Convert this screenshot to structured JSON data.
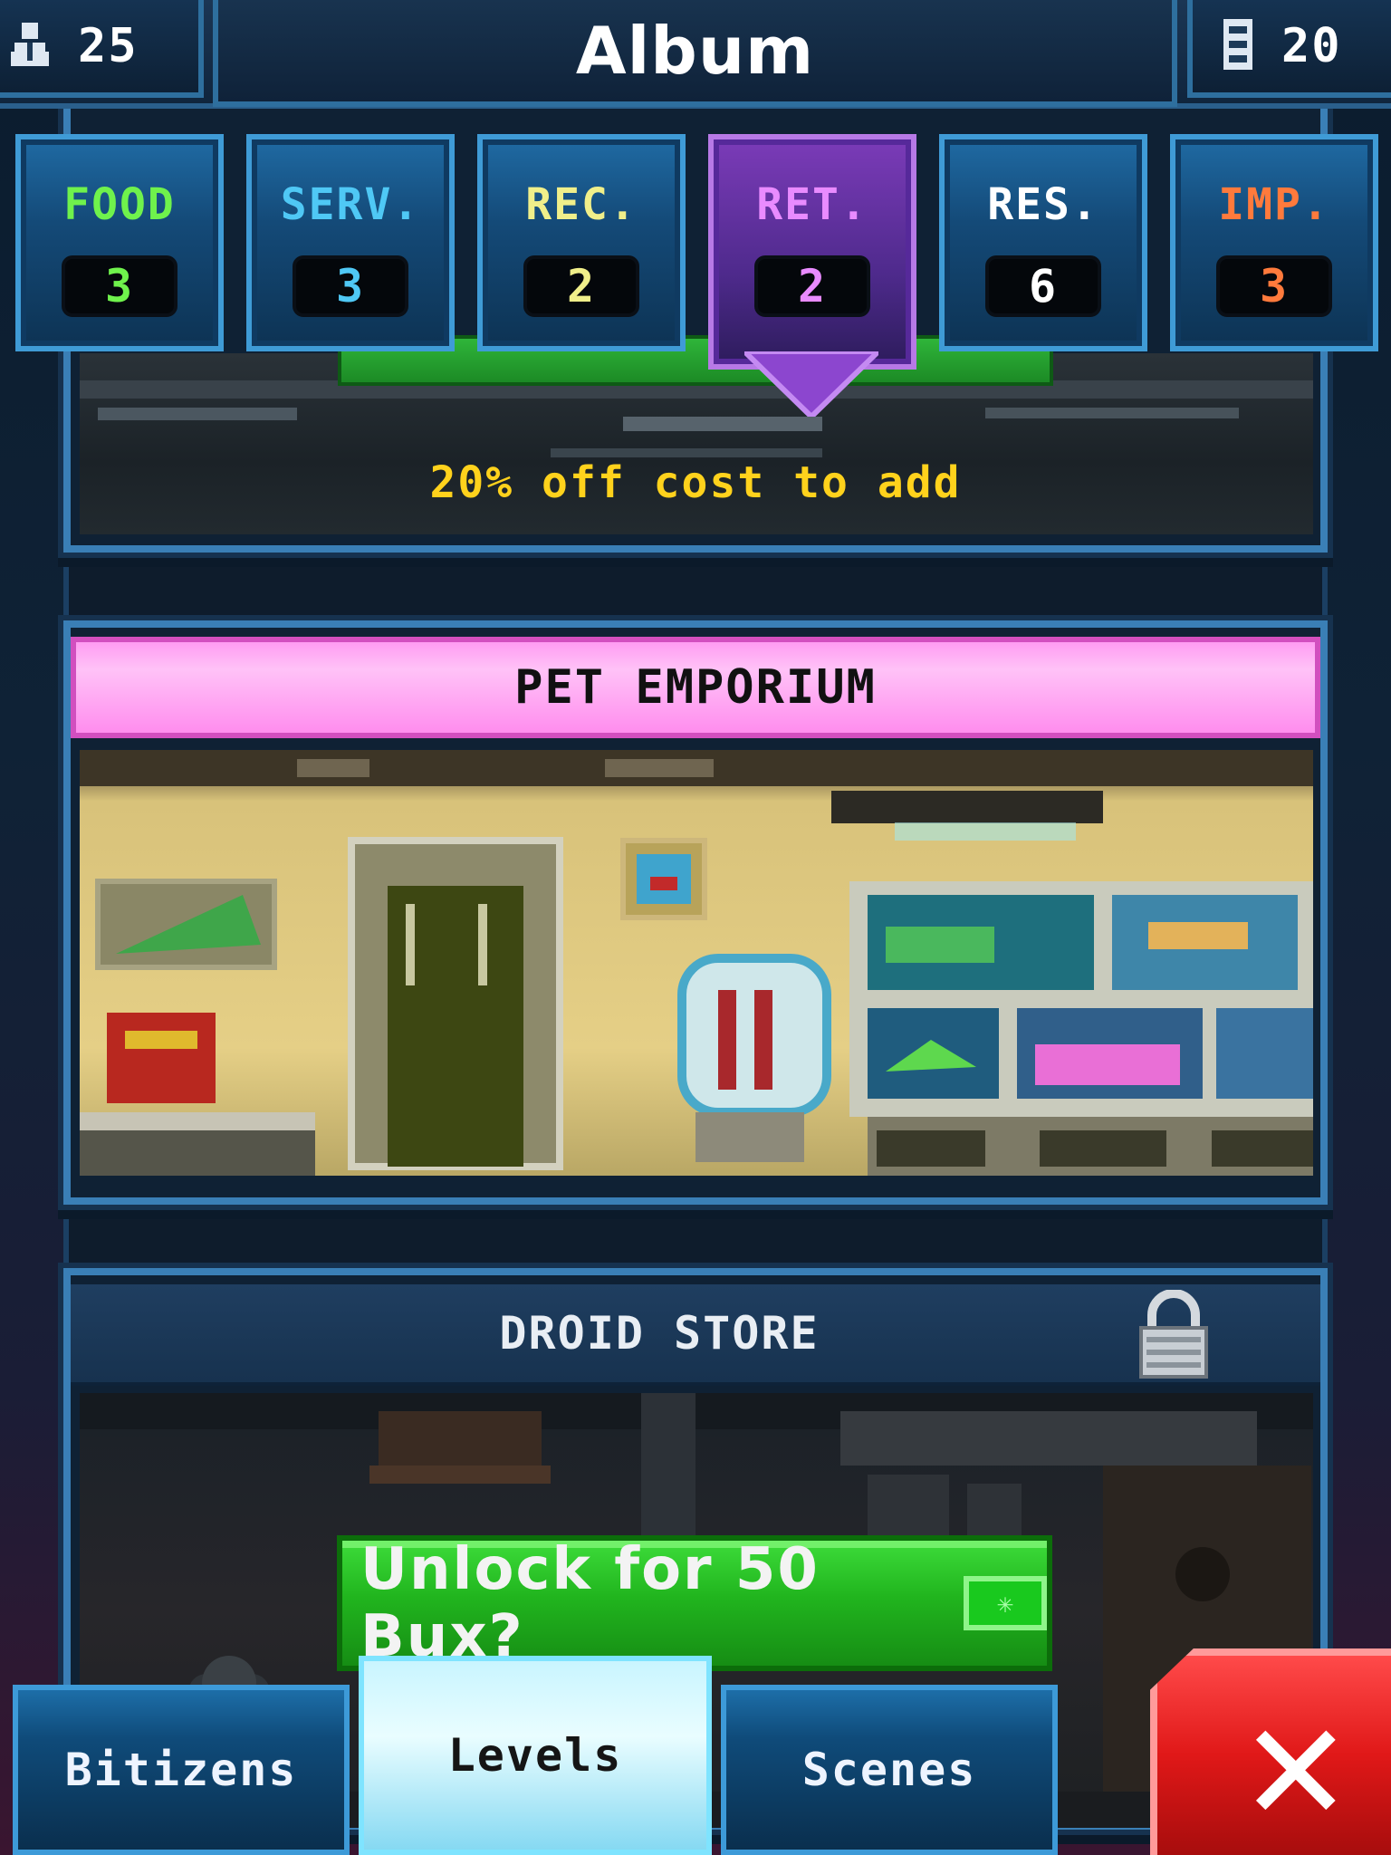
{
  "header": {
    "title": "Album",
    "bitizens_count": "25",
    "floors_count": "20"
  },
  "categories": [
    {
      "label": "FOOD",
      "count": "3",
      "color": "#6ff24c"
    },
    {
      "label": "SERV.",
      "count": "3",
      "color": "#4fc8f5"
    },
    {
      "label": "REC.",
      "count": "2",
      "color": "#f0ef8a"
    },
    {
      "label": "RET.",
      "count": "2",
      "color": "#e98bff"
    },
    {
      "label": "RES.",
      "count": "6",
      "color": "#ffffff"
    },
    {
      "label": "IMP.",
      "count": "3",
      "color": "#ff7a3c"
    }
  ],
  "active_category": "RET.",
  "cards": {
    "top_bonus": "20% off cost to add",
    "pet_emporium": "PET EMPORIUM",
    "droid_store": "DROID STORE"
  },
  "unlock": {
    "label": "Unlock for 50 Bux?"
  },
  "nav": {
    "bitizens": "Bitizens",
    "levels": "Levels",
    "scenes": "Scenes",
    "active": "Levels"
  },
  "icons": [
    "bitizen-icon",
    "elevator-icon",
    "lock-icon",
    "bux-icon",
    "close-icon"
  ]
}
